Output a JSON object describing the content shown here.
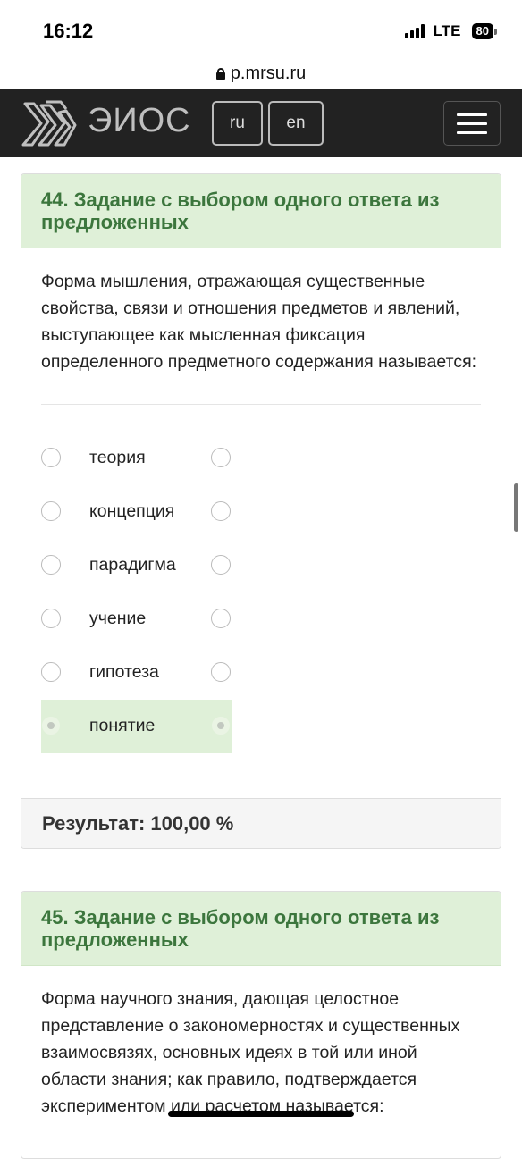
{
  "status_bar": {
    "time": "16:12",
    "network": "LTE",
    "battery": "80"
  },
  "browser": {
    "url": "p.mrsu.ru"
  },
  "header": {
    "brand": "ЭИОС",
    "lang_ru": "ru",
    "lang_en": "en"
  },
  "cards": [
    {
      "title": "44. Задание с выбором одного ответа из предложенных",
      "question": "Форма мышления, отражающая существенные свойства, связи и отношения предметов и явлений, выступающее как мысленная фиксация определенного предметного содержания называется:",
      "options": [
        {
          "label": "теория",
          "selected": false
        },
        {
          "label": "концепция",
          "selected": false
        },
        {
          "label": "парадигма",
          "selected": false
        },
        {
          "label": "учение",
          "selected": false
        },
        {
          "label": "гипотеза",
          "selected": false
        },
        {
          "label": "понятие",
          "selected": true
        }
      ],
      "result_label": "Результат:",
      "result_value": "100,00 %"
    },
    {
      "title": "45. Задание с выбором одного ответа из предложенных",
      "question": "Форма научного знания, дающая целостное представление о закономерностях и существенных взаимосвязях, основных идеях в той или иной области знания; как правило, подтверждается экспериментом или расчетом называется:"
    }
  ],
  "colors": {
    "header_bg": "#222222",
    "card_head_bg": "#dff0d8",
    "card_head_text": "#3c763d"
  }
}
